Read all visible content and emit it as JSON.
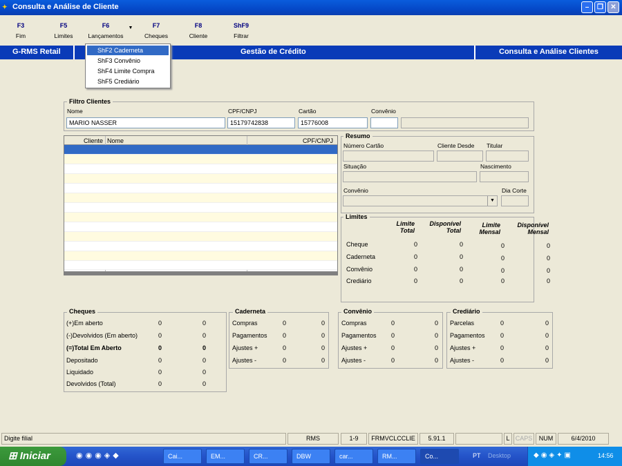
{
  "window": {
    "title": "Consulta e Análise de Cliente"
  },
  "toolbar": {
    "buttons": [
      {
        "key": "F3",
        "label": "Fim"
      },
      {
        "key": "F5",
        "label": "Limites"
      },
      {
        "key": "F6",
        "label": "Lançamentos"
      },
      {
        "key": "F7",
        "label": "Cheques"
      },
      {
        "key": "F8",
        "label": "Cliente"
      },
      {
        "key": "ShF9",
        "label": "Filtrar"
      }
    ]
  },
  "dropdown_menu": {
    "items": [
      "ShF2  Caderneta",
      "ShF3  Convênio",
      "ShF4  Limite Compra",
      "ShF5  Crediário"
    ]
  },
  "banner": {
    "left": "G-RMS Retail",
    "center": "Gestão de Crédito",
    "right": "Consulta e Análise Clientes"
  },
  "filtro": {
    "title": "Filtro Clientes",
    "nome_label": "Nome",
    "nome_value": "MARIO NASSER",
    "cpf_label": "CPF/CNPJ",
    "cpf_value": "15179742838",
    "cartao_label": "Cartão",
    "cartao_value": "15776008",
    "convenio_label": "Convênio",
    "convenio_value": ""
  },
  "grid": {
    "columns": [
      "Cliente",
      "Nome",
      "CPF/CNPJ"
    ]
  },
  "resumo": {
    "title": "Resumo",
    "numero_cartao": "Número Cartão",
    "cliente_desde": "Cliente Desde",
    "titular": "Titular",
    "situacao": "Situação",
    "nascimento": "Nascimento",
    "convenio": "Convênio",
    "dia_corte": "Dia Corte"
  },
  "limites": {
    "title": "Limites",
    "headers": [
      [
        "Limite",
        "Total"
      ],
      [
        "Disponível",
        "Total"
      ],
      [
        "Limite",
        "Mensal"
      ],
      [
        "Disponível",
        "Mensal"
      ]
    ],
    "rows": [
      {
        "label": "Cheque",
        "values": [
          "0",
          "0",
          "0",
          "0"
        ]
      },
      {
        "label": "Caderneta",
        "values": [
          "0",
          "0",
          "0",
          "0"
        ]
      },
      {
        "label": "Convênio",
        "values": [
          "0",
          "0",
          "0",
          "0"
        ]
      },
      {
        "label": "Crediário",
        "values": [
          "0",
          "0",
          "0",
          "0"
        ]
      }
    ]
  },
  "cheques": {
    "title": "Cheques",
    "rows": [
      {
        "label": "(+)Em aberto",
        "a": "0",
        "b": "0",
        "bold": false
      },
      {
        "label": "(-)Devolvidos (Em aberto)",
        "a": "0",
        "b": "0",
        "bold": false
      },
      {
        "label": "(=)Total Em Aberto",
        "a": "0",
        "b": "0",
        "bold": true
      },
      {
        "label": "Depositado",
        "a": "0",
        "b": "0",
        "bold": false
      },
      {
        "label": "Liquidado",
        "a": "0",
        "b": "0",
        "bold": false
      },
      {
        "label": "Devolvidos (Total)",
        "a": "0",
        "b": "0",
        "bold": false
      }
    ]
  },
  "caderneta": {
    "title": "Caderneta",
    "rows": [
      {
        "label": "Compras",
        "a": "0",
        "b": "0"
      },
      {
        "label": "Pagamentos",
        "a": "0",
        "b": "0"
      },
      {
        "label": "Ajustes +",
        "a": "0",
        "b": "0"
      },
      {
        "label": "Ajustes -",
        "a": "0",
        "b": "0"
      }
    ]
  },
  "convenio_box": {
    "title": "Convênio",
    "rows": [
      {
        "label": "Compras",
        "a": "0",
        "b": "0"
      },
      {
        "label": "Pagamentos",
        "a": "0",
        "b": "0"
      },
      {
        "label": "Ajustes +",
        "a": "0",
        "b": "0"
      },
      {
        "label": "Ajustes -",
        "a": "0",
        "b": "0"
      }
    ]
  },
  "crediario": {
    "title": "Crediário",
    "rows": [
      {
        "label": "Parcelas",
        "a": "0",
        "b": "0"
      },
      {
        "label": "Pagamentos",
        "a": "0",
        "b": "0"
      },
      {
        "label": "Ajustes +",
        "a": "0",
        "b": "0"
      },
      {
        "label": "Ajustes -",
        "a": "0",
        "b": "0"
      }
    ]
  },
  "statusbar": {
    "message": "Digite filial",
    "panels": [
      "RMS",
      "1-9",
      "FRMVCLCCLIE",
      "5.91.1",
      "",
      "L",
      "CAPS",
      "NUM",
      "6/4/2010"
    ]
  },
  "taskbar": {
    "start_label": "Iniciar",
    "tasks": [
      "Cai...",
      "EM...",
      "CR...",
      "DBW",
      "car...",
      "RM...",
      "Co..."
    ],
    "language": "PT",
    "desktop": "Desktop",
    "clock": "14:56"
  },
  "colors": {
    "titlebar": "#0548c8",
    "banner": "#0a3bb8",
    "selection": "#316ac5",
    "row_alt": "#fffbe0"
  }
}
